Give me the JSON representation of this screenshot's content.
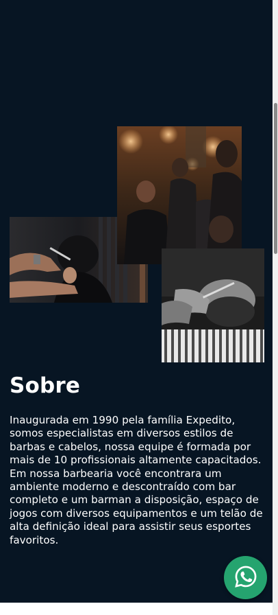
{
  "about": {
    "title": "Sobre",
    "text": "Inaugurada em 1990 pela família Expedito, somos especialistas em diversos estilos de barbas e cabelos, nossa equipe é formada por mais de 10 profissionais altamente capacitados. Em nossa barbearia você encontrara um ambiente moderno e descontraído com bar completo e um barman a disposição, espaço de jogos com diversos equipamentos e um telão de alta definição ideal para assistir seus esportes favoritos."
  },
  "gallery": {
    "photos": [
      "barber-cutting-hair-photo",
      "barbershop-interior-photo",
      "beard-trim-photo"
    ]
  },
  "floating": {
    "whatsapp_icon": "whatsapp-icon"
  },
  "colors": {
    "background": "#071523",
    "text": "#ffffff",
    "whatsapp": "#25a46f"
  }
}
